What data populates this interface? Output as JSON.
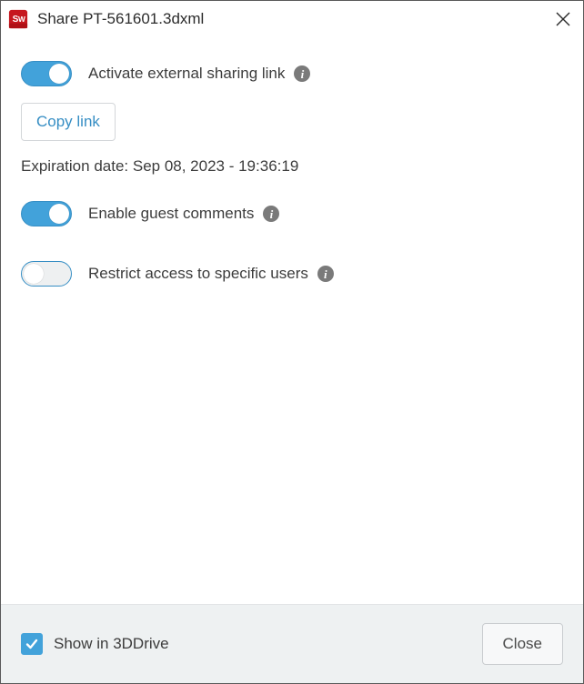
{
  "window": {
    "title": "Share PT-561601.3dxml"
  },
  "options": {
    "activate_sharing": {
      "label": "Activate external sharing link",
      "state": true
    },
    "copy_link_label": "Copy link",
    "expiration_text": "Expiration date: Sep 08, 2023 - 19:36:19",
    "guest_comments": {
      "label": "Enable guest comments",
      "state": true
    },
    "restrict_access": {
      "label": "Restrict access to specific users",
      "state": false
    }
  },
  "footer": {
    "show_in_3ddrive": {
      "label": "Show in 3DDrive",
      "checked": true
    },
    "close_label": "Close"
  }
}
